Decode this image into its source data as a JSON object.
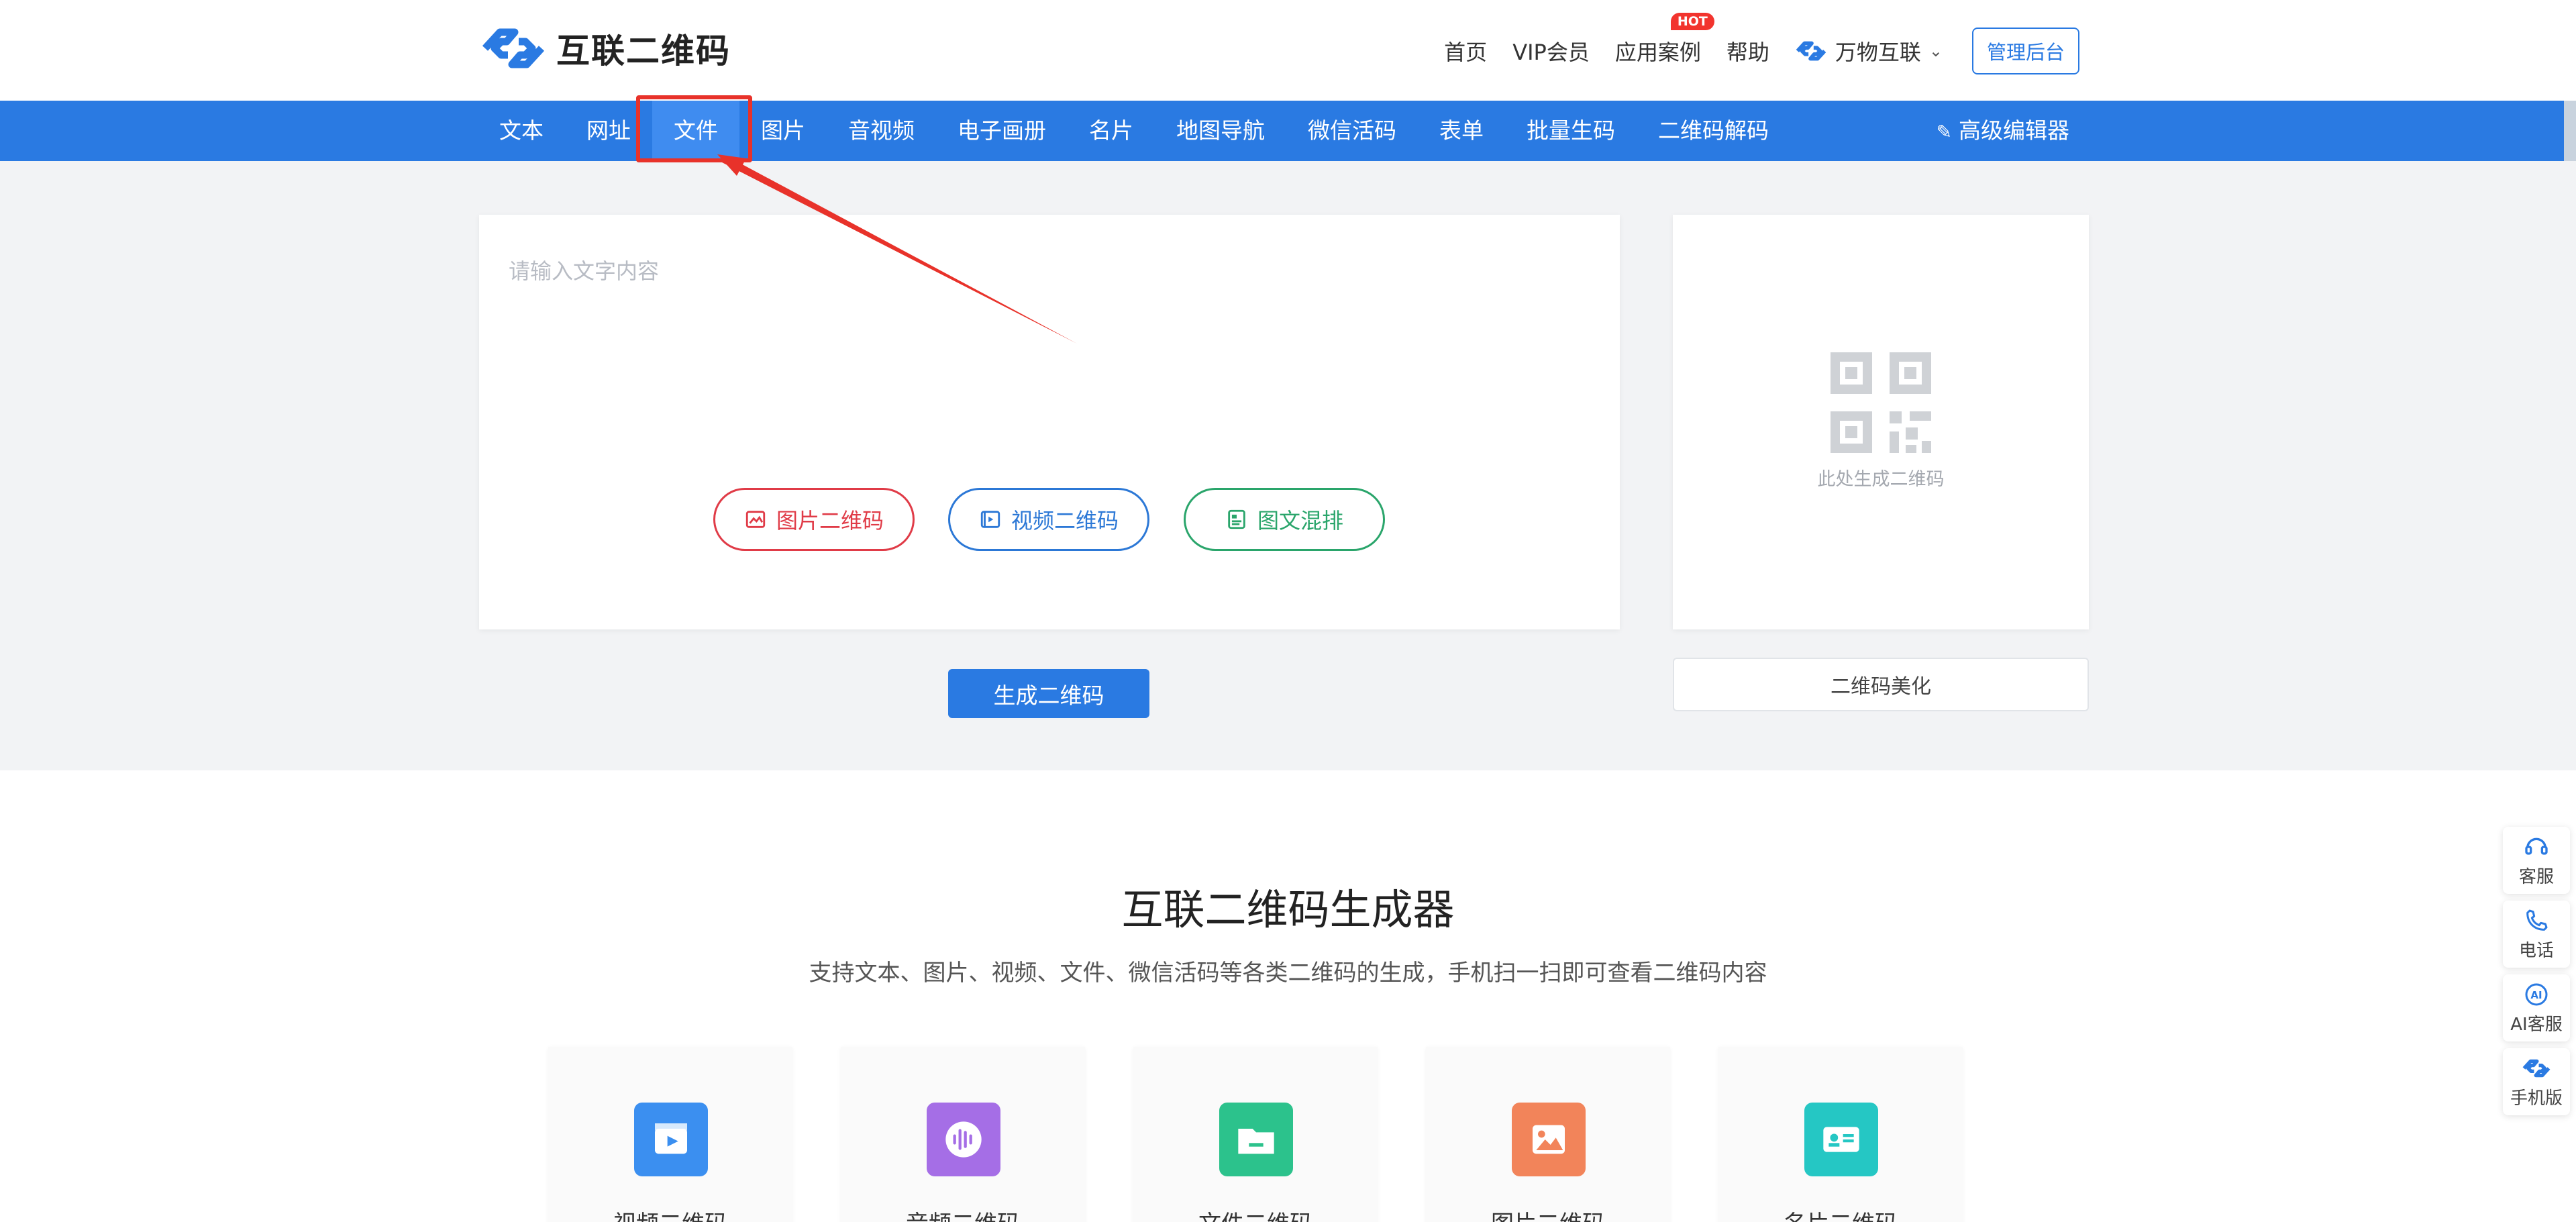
{
  "header": {
    "logo_text": "互联二维码",
    "links": {
      "home": "首页",
      "vip": "VIP会员",
      "cases": "应用案例",
      "hot_badge": "HOT",
      "help": "帮助",
      "brand": "万物互联",
      "admin": "管理后台"
    }
  },
  "nav": {
    "items": [
      "文本",
      "网址",
      "文件",
      "图片",
      "音视频",
      "电子画册",
      "名片",
      "地图导航",
      "微信活码",
      "表单",
      "批量生码",
      "二维码解码"
    ],
    "active_index": 2,
    "advanced_editor": "高级编辑器"
  },
  "editor": {
    "placeholder": "请输入文字内容",
    "buttons": {
      "image_qr": "图片二维码",
      "video_qr": "视频二维码",
      "mixed": "图文混排"
    },
    "generate": "生成二维码"
  },
  "qr_preview": {
    "caption": "此处生成二维码",
    "beautify": "二维码美化"
  },
  "section": {
    "title": "互联二维码生成器",
    "subtitle": "支持文本、图片、视频、文件、微信活码等各类二维码的生成，手机扫一扫即可查看二维码内容",
    "features": [
      {
        "label": "视频二维码",
        "icon": "video-icon",
        "color": "#3b8ff0"
      },
      {
        "label": "音频二维码",
        "icon": "audio-icon",
        "color": "#a56ee6"
      },
      {
        "label": "文件二维码",
        "icon": "folder-icon",
        "color": "#2cc28c"
      },
      {
        "label": "图片二维码",
        "icon": "image-icon",
        "color": "#f2845a"
      },
      {
        "label": "名片二维码",
        "icon": "id-card-icon",
        "color": "#25c7c4"
      }
    ]
  },
  "side": {
    "support": "客服",
    "phone": "电话",
    "ai": "AI客服",
    "mobile": "手机版"
  },
  "colors": {
    "primary": "#2a7ae2",
    "annotation_red": "#e8322a"
  }
}
